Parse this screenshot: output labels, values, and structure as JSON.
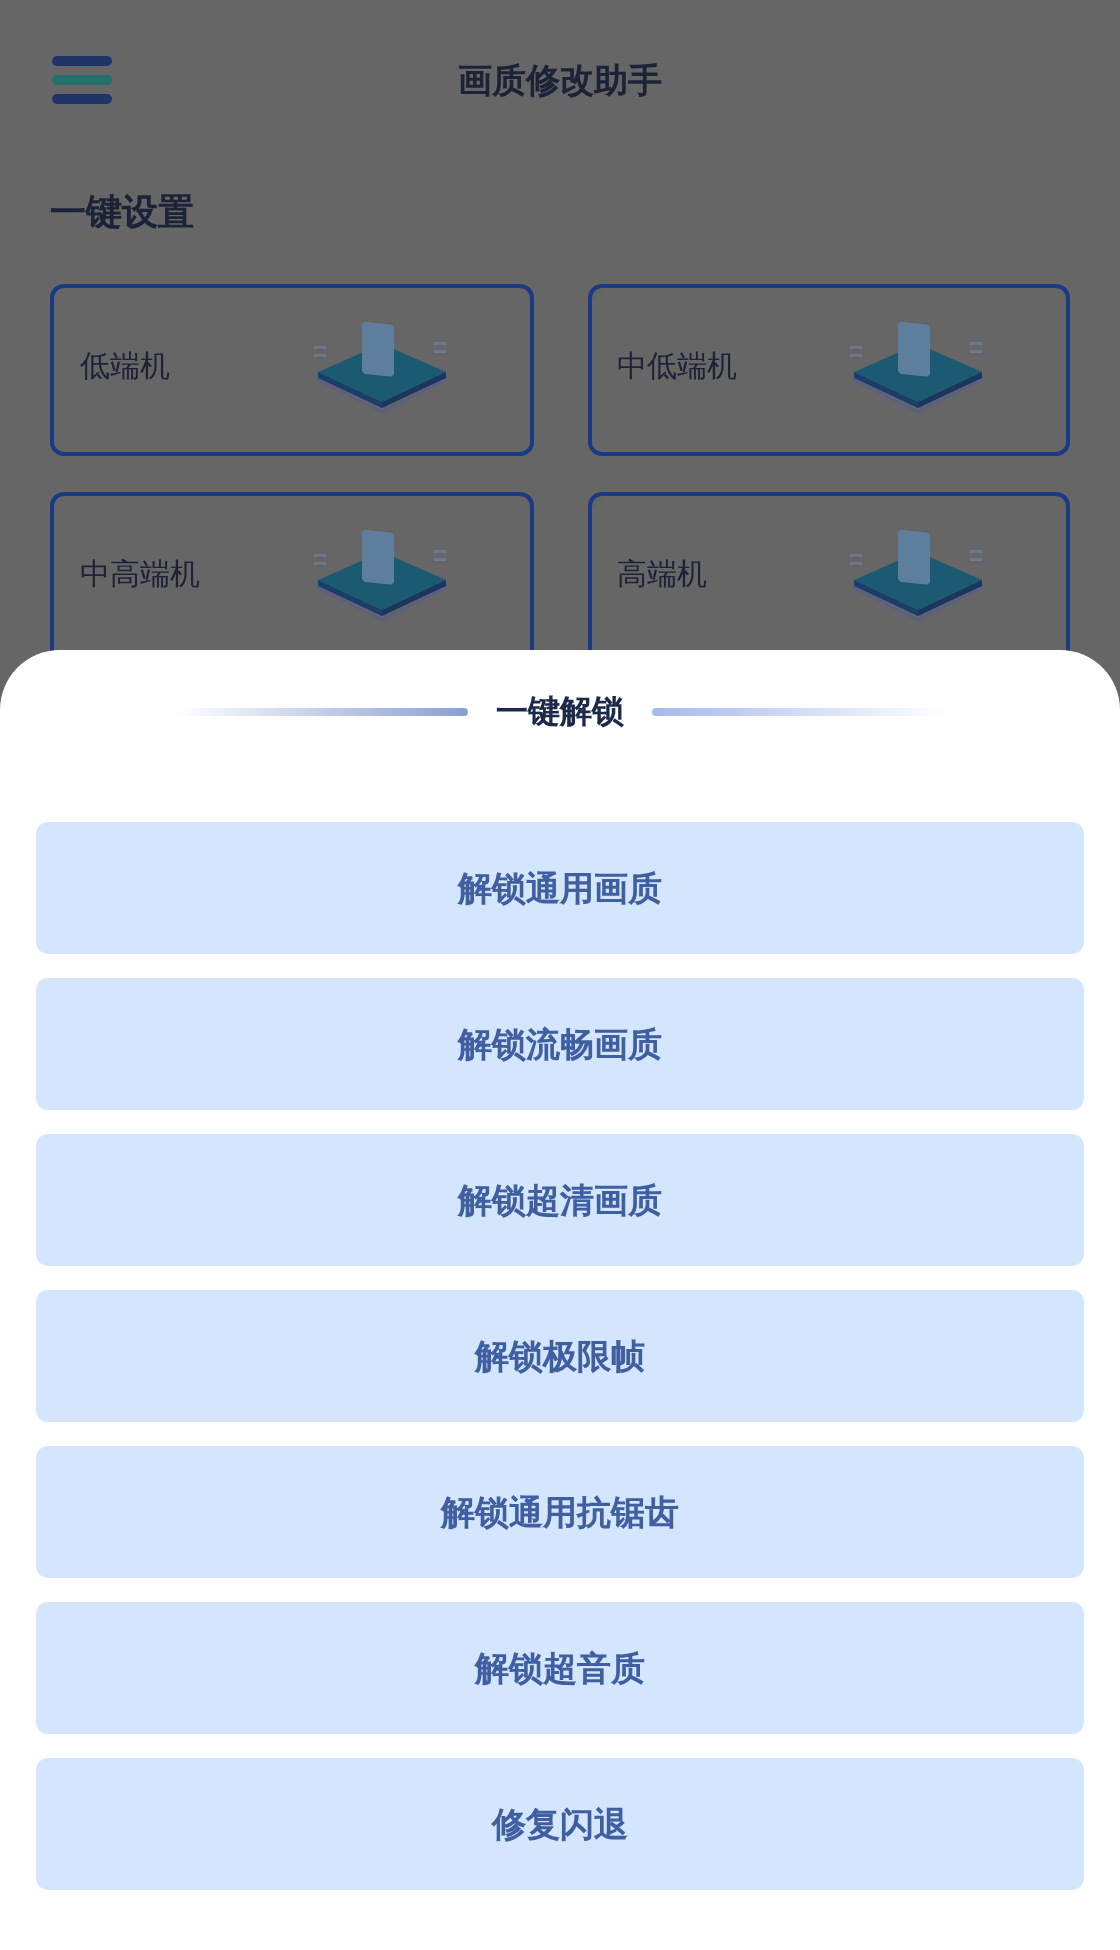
{
  "header": {
    "title": "画质修改助手"
  },
  "presets": {
    "title": "一键设置",
    "cards": [
      {
        "label": "低端机"
      },
      {
        "label": "中低端机"
      },
      {
        "label": "中高端机"
      },
      {
        "label": "高端机"
      }
    ]
  },
  "sheet": {
    "title": "一键解锁",
    "buttons": [
      "解锁通用画质",
      "解锁流畅画质",
      "解锁超清画质",
      "解锁极限帧",
      "解锁通用抗锯齿",
      "解锁超音质",
      "修复闪退"
    ]
  }
}
